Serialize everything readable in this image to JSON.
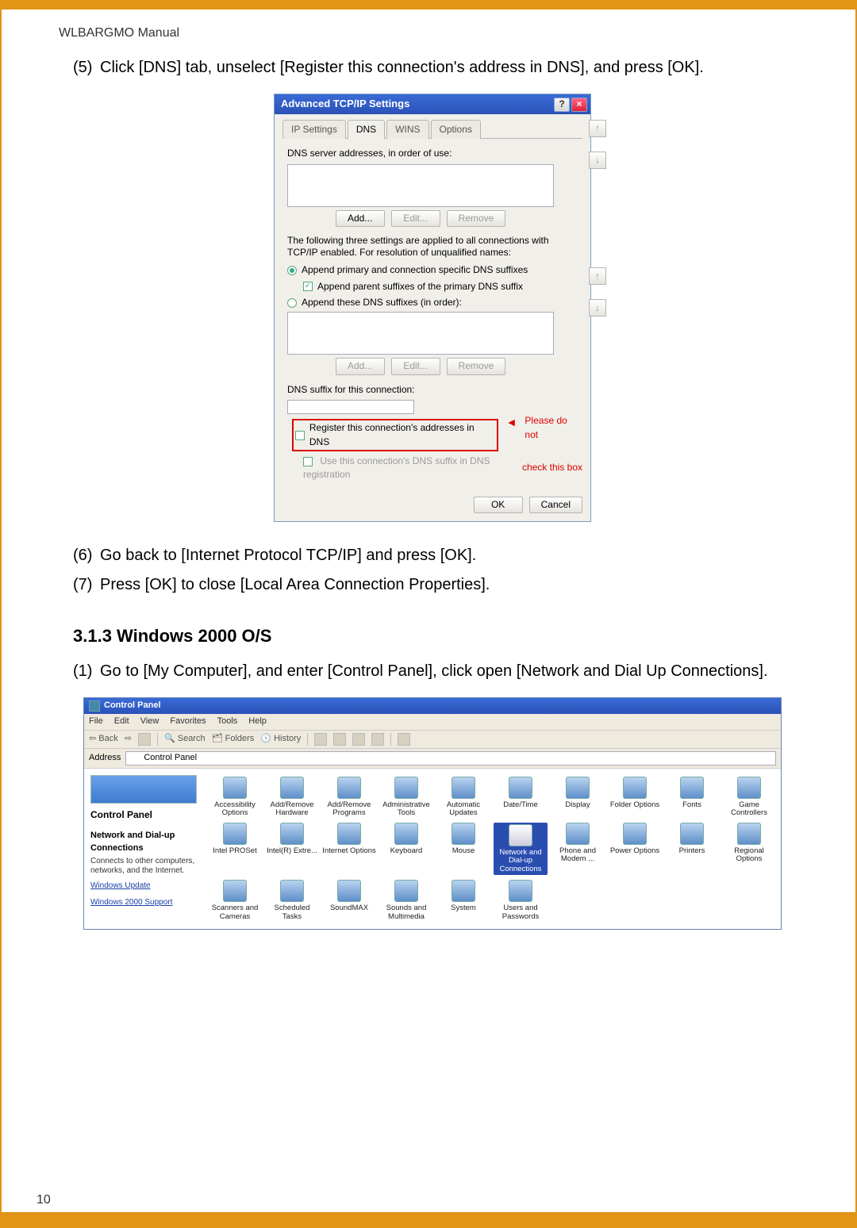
{
  "header": "WLBARGMO Manual",
  "page_number": "10",
  "steps_top": [
    {
      "num": "(5)",
      "text": "Click [DNS] tab, unselect [Register this connection's address in DNS], and press [OK]."
    }
  ],
  "steps_mid": [
    {
      "num": "(6)",
      "text": "Go back to [Internet Protocol TCP/IP] and press [OK]."
    },
    {
      "num": "(7)",
      "text": "Press [OK] to close [Local Area Connection Properties]."
    }
  ],
  "section_heading": "3.1.3 Windows 2000 O/S",
  "steps_bottom": [
    {
      "num": "(1)",
      "text": "Go to [My Computer], and enter [Control Panel], click open [Network and Dial Up Connections]."
    }
  ],
  "dialog": {
    "title": "Advanced TCP/IP Settings",
    "help_btn": "?",
    "close_btn": "×",
    "tabs": [
      "IP Settings",
      "DNS",
      "WINS",
      "Options"
    ],
    "active_tab": 1,
    "dns_label": "DNS server addresses, in order of use:",
    "btn_add": "Add...",
    "btn_edit": "Edit...",
    "btn_remove": "Remove",
    "para1": "The following three settings are applied to all connections with TCP/IP enabled. For resolution of unqualified names:",
    "radio1": "Append primary and connection specific DNS suffixes",
    "chk_parent": "Append parent suffixes of the primary DNS suffix",
    "radio2": "Append these DNS suffixes (in order):",
    "suffix_label": "DNS suffix for this connection:",
    "chk_register": "Register this connection's addresses in DNS",
    "chk_usesuffix": "Use this connection's DNS suffix in DNS registration",
    "annot1": "Please do not",
    "annot2": "check this box",
    "ok": "OK",
    "cancel": "Cancel"
  },
  "cp": {
    "title": "Control Panel",
    "menus": [
      "File",
      "Edit",
      "View",
      "Favorites",
      "Tools",
      "Help"
    ],
    "tool_back": "Back",
    "tool_search": "Search",
    "tool_folders": "Folders",
    "tool_history": "History",
    "addr_label": "Address",
    "addr_value": "Control Panel",
    "left_heading": "Control Panel",
    "left_bold": "Network and Dial-up Connections",
    "left_desc": "Connects to other computers, networks, and the Internet.",
    "left_link1": "Windows Update",
    "left_link2": "Windows 2000 Support",
    "icons": [
      "Accessibility Options",
      "Add/Remove Hardware",
      "Add/Remove Programs",
      "Administrative Tools",
      "Automatic Updates",
      "Date/Time",
      "Display",
      "Folder Options",
      "Fonts",
      "Game Controllers",
      "Intel PROSet",
      "Intel(R) Extre...",
      "Internet Options",
      "Keyboard",
      "Mouse",
      "Network and Dial-up Connections",
      "Phone and Modem ...",
      "Power Options",
      "Printers",
      "Regional Options",
      "Scanners and Cameras",
      "Scheduled Tasks",
      "SoundMAX",
      "Sounds and Multimedia",
      "System",
      "Users and Passwords"
    ],
    "highlight_index": 15
  }
}
